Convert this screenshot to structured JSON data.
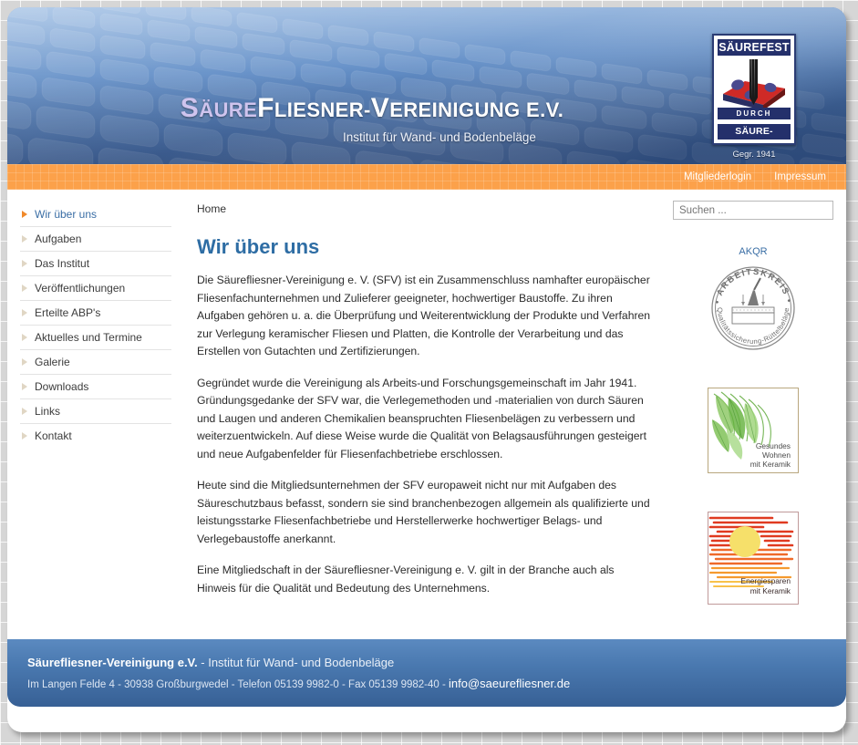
{
  "header": {
    "title_part1": "Säure",
    "title_part2": "Fliesner-Vereinigung e.V.",
    "title_s": "S",
    "title_aeure": "ÄURE",
    "title_f": "F",
    "title_liesner": "LIESNER-",
    "title_v": "V",
    "title_ereinigung": "EREINIGUNG E.V.",
    "subtitle": "Institut für Wand- und Bodenbeläge",
    "logo": {
      "top_text": "SÄUREFEST",
      "middle_text": "DURCH",
      "bottom_text": "SÄURE-FLIESNER",
      "caption": "Gegr. 1941"
    }
  },
  "topnav": {
    "items": [
      {
        "label": "Mitgliederlogin"
      },
      {
        "label": "Impressum"
      }
    ]
  },
  "sidebar": {
    "items": [
      {
        "label": "Wir über uns",
        "active": true
      },
      {
        "label": "Aufgaben",
        "active": false
      },
      {
        "label": "Das Institut",
        "active": false
      },
      {
        "label": "Veröffentlichungen",
        "active": false
      },
      {
        "label": "Erteilte ABP's",
        "active": false
      },
      {
        "label": "Aktuelles und Termine",
        "active": false
      },
      {
        "label": "Galerie",
        "active": false
      },
      {
        "label": "Downloads",
        "active": false
      },
      {
        "label": "Links",
        "active": false
      },
      {
        "label": "Kontakt",
        "active": false
      }
    ]
  },
  "main": {
    "breadcrumb": "Home",
    "title": "Wir über uns",
    "paragraphs": [
      "Die Säurefliesner-Vereinigung e. V. (SFV) ist ein Zusammenschluss namhafter europäischer Fliesenfachunternehmen und Zulieferer geeigneter, hochwertiger Baustoffe. Zu ihren Aufgaben gehören u. a. die Überprüfung und Weiterentwicklung der Produkte und Verfahren zur Verlegung keramischer Fliesen und Platten, die Kontrolle der Verarbeitung und das Erstellen von Gutachten und Zertifizierungen.",
      "Gegründet wurde die Vereinigung als Arbeits-und Forschungsgemeinschaft im Jahr 1941. Gründungsgedanke der SFV war, die Verlegemethoden und -materialien von durch Säuren und Laugen und anderen Chemikalien beanspruchten Fliesenbelägen zu verbessern und weiterzuentwickeln. Auf diese Weise wurde die Qualität von Belagsausführungen gesteigert und neue Aufgabenfelder für Fliesenfachbetriebe erschlossen.",
      "Heute sind die Mitgliedsunternehmen der SFV europaweit nicht nur mit Aufgaben des Säureschutzbaus befasst, sondern sie sind branchenbezogen allgemein als qualifizierte und leistungsstarke Fliesenfachbetriebe und Herstellerwerke hochwertiger Belags- und Verlegebaustoffe anerkannt.",
      "Eine Mitgliedschaft in der Säurefliesner-Vereinigung e. V. gilt in der Branche auch als Hinweis für die Qualität und Bedeutung des Unternehmens."
    ]
  },
  "rightcol": {
    "search_placeholder": "Suchen ...",
    "search_value": "",
    "akqr_label": "AKQR",
    "akqr_seal_top": "ARBEITSKREIS",
    "akqr_seal_bottom": "Qualitätssicherung-Rüttelbeläge",
    "banner1_line1": "Gesundes",
    "banner1_line2": "Wohnen",
    "banner1_line3": "mit Keramik",
    "banner2_line1": "Energiesparen",
    "banner2_line2": "mit Keramik"
  },
  "footer": {
    "org_name": "Säurefliesner-Vereinigung e.V.",
    "org_tagline": " - Institut für Wand- und Bodenbeläge",
    "address": "Im Langen Felde 4 - 30938 Großburgwedel - Telefon 05139 9982-0 - Fax 05139 9982-40 - ",
    "email": "info@saeurefliesner.de"
  },
  "colors": {
    "accent_orange": "#fca14a",
    "link_blue": "#3a6ea5",
    "title_blue": "#2e6da4",
    "header_blue": "#4a6fa8",
    "footer_blue": "#4a79b0"
  }
}
